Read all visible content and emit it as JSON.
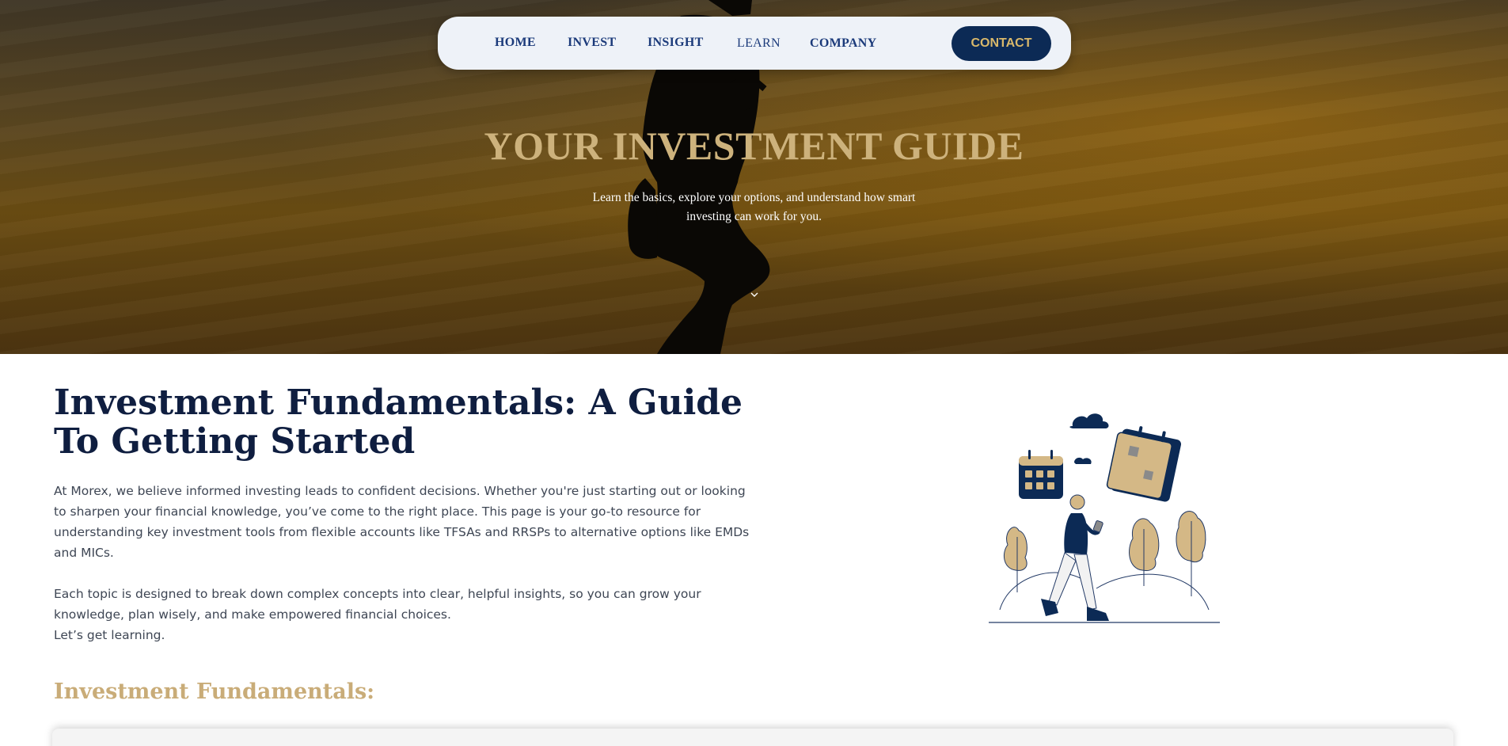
{
  "nav": {
    "items": [
      {
        "label": "HOME"
      },
      {
        "label": "INVEST"
      },
      {
        "label": "INSIGHT"
      },
      {
        "label": "LEARN"
      },
      {
        "label": "COMPANY"
      }
    ],
    "contact_label": "CONTACT"
  },
  "hero": {
    "title": "YOUR INVESTMENT GUIDE",
    "subtitle_line1": "Learn the basics, explore your options, and understand how smart",
    "subtitle_line2": "investing can work for you.",
    "scroll_icon": "chevron-down-icon"
  },
  "main": {
    "title": "Investment Fundamentals: A Guide To Getting Started",
    "paragraph1": "At Morex, we believe informed investing leads to confident decisions. Whether you're just starting out or looking to sharpen your financial knowledge, you’ve come to the right place. This page is your go-to resource for understanding key investment tools from flexible accounts like TFSAs and RRSPs to alternative options like EMDs and MICs.",
    "paragraph2": "Each topic is designed to break down complex concepts into clear, helpful insights, so you can grow your knowledge, plan wisely, and make empowered financial choices.",
    "paragraph3": "Let’s get learning.",
    "section_title": "Investment Fundamentals:"
  },
  "colors": {
    "navy": "#0c2a55",
    "gold": "#cdb27c",
    "nav_text": "#1b3a7a",
    "nav_bg": "#eef2f8"
  }
}
